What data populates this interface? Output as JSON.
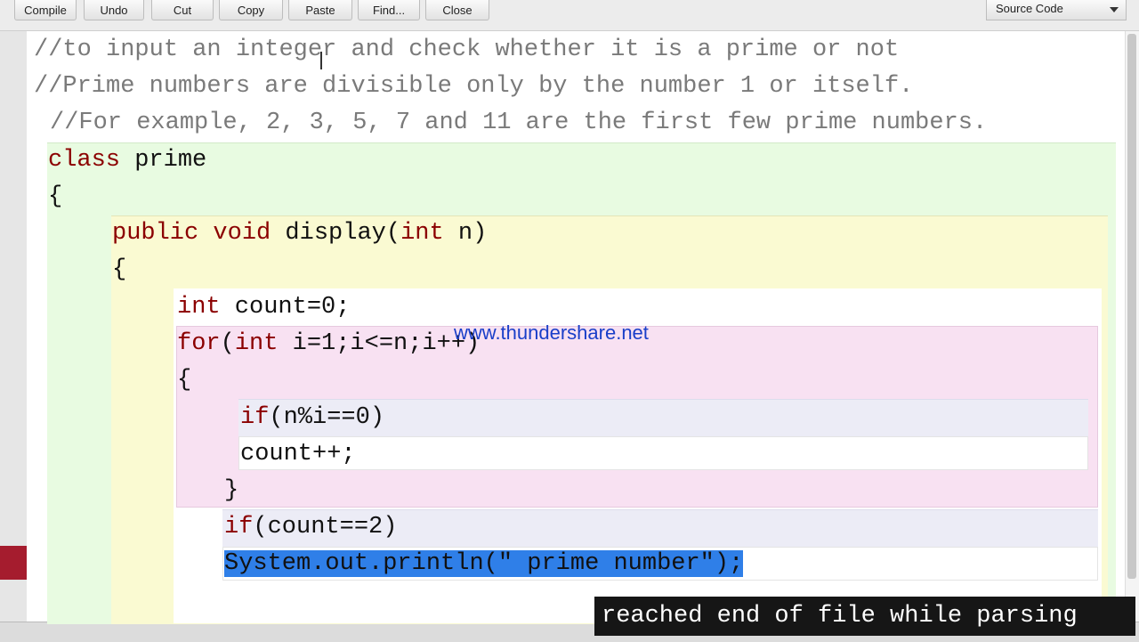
{
  "toolbar": {
    "buttons": [
      "Compile",
      "Undo",
      "Cut",
      "Copy",
      "Paste",
      "Find...",
      "Close"
    ],
    "view_select": "Source Code"
  },
  "code": {
    "lines": [
      "//to input an integer and check whether it is a prime or not",
      "//Prime numbers are divisible only by the number 1 or itself.",
      "//For example, 2, 3, 5, 7 and 11 are the first few prime numbers.",
      "class prime",
      "{",
      "public void display(int n)",
      "{",
      "int count=0;",
      "for(int i=1;i<=n;i++)",
      "{",
      "if(n%i==0)",
      "count++;",
      "}",
      "if(count==2)",
      "System.out.println(\" prime number\");"
    ]
  },
  "watermark": "www.thundershare.net",
  "status_message": "reached end of file while parsing",
  "colors": {
    "keyword": "#8b0000",
    "comment": "#7a7a7a",
    "selection": "#2f7fe8",
    "class_scope": "#e8fbe1",
    "method_scope": "#fafad2",
    "loop_scope": "#f8e1f2",
    "if_scope": "#ececf6",
    "breakpoint": "#a51c2e"
  }
}
